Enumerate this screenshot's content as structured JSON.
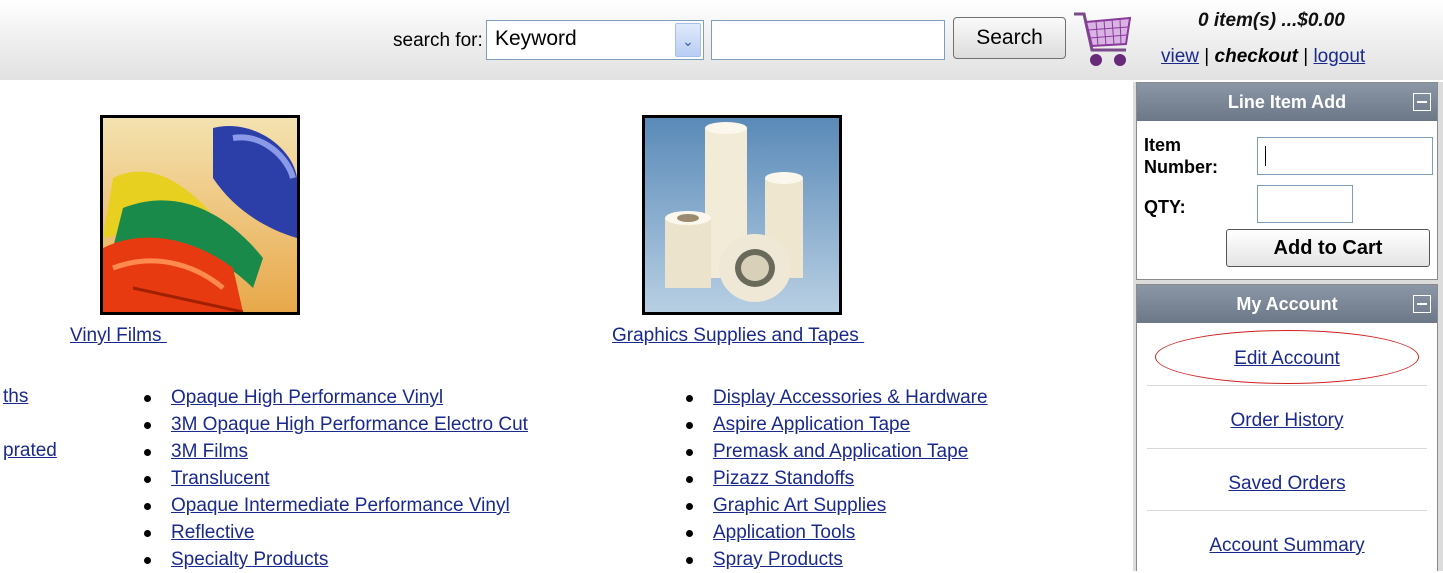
{
  "header": {
    "search_label": "search for:",
    "search_type": "Keyword",
    "search_query": "",
    "search_button": "Search",
    "cart_summary": "0 item(s) ...$0.00",
    "view_link": "view",
    "separator": "|",
    "checkout_link": "checkout",
    "logout_link": "logout"
  },
  "categories": [
    {
      "title": "Vinyl Films",
      "image": "vinyl-rolls"
    },
    {
      "title": "Graphics Supplies and Tapes",
      "image": "tape-rolls"
    }
  ],
  "left_list": [
    "ths",
    "",
    "prated"
  ],
  "vinyl_list": [
    "Opaque High Performance Vinyl",
    "3M Opaque High Performance Electro Cut",
    "3M Films",
    "Translucent",
    "Opaque Intermediate Performance Vinyl",
    "Reflective",
    "Specialty Products"
  ],
  "tapes_list": [
    "Display Accessories & Hardware",
    "Aspire Application Tape",
    "Premask and Application Tape",
    "Pizazz Standoffs",
    "Graphic Art Supplies",
    "Application Tools",
    "Spray Products"
  ],
  "sidebar": {
    "line_item": {
      "title": "Line Item Add",
      "item_label_1": "Item",
      "item_label_2": "Number:",
      "qty_label": "QTY:",
      "add_button": "Add to Cart"
    },
    "account": {
      "title": "My Account",
      "links": [
        "Edit Account",
        "Order History",
        "Saved Orders",
        "Account Summary"
      ]
    }
  },
  "colors": {
    "link": "#1a2a8c",
    "panel_header": "#7a8596",
    "highlight": "#d02020"
  }
}
